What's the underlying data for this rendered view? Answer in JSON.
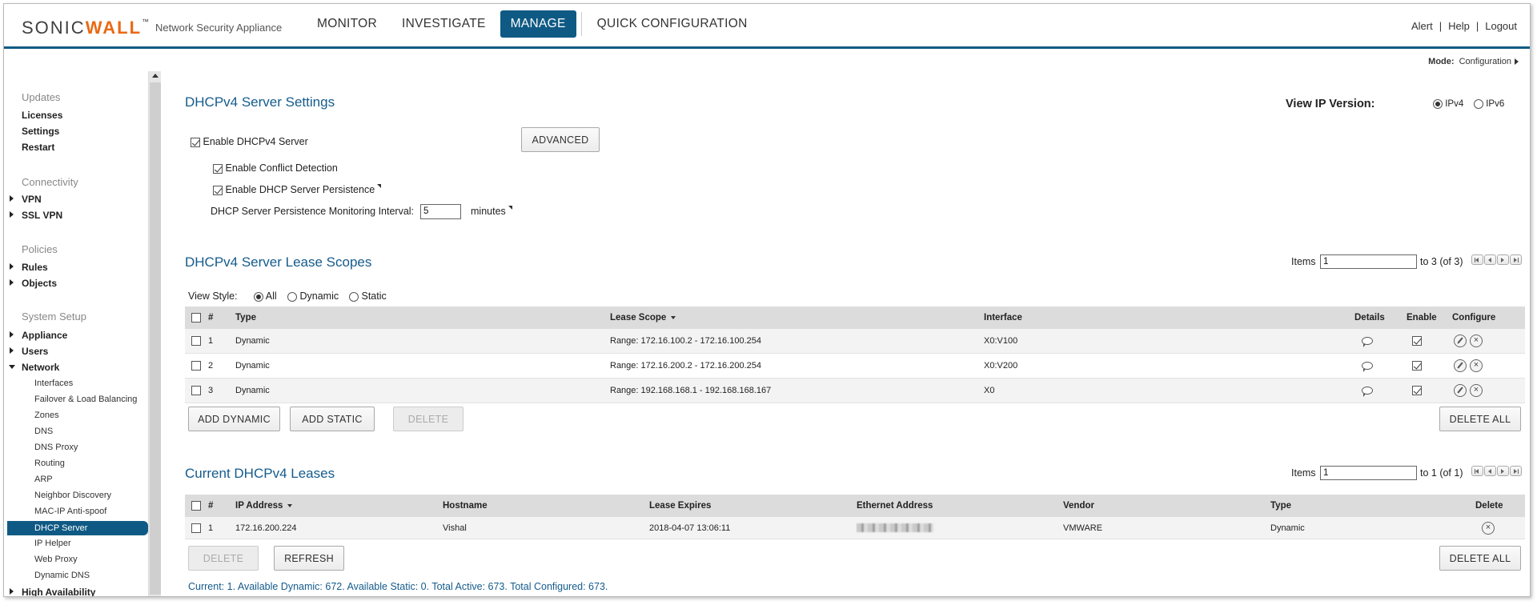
{
  "header": {
    "logo_left": "SONIC",
    "logo_accent": "WALL",
    "logo_tm": "™",
    "product": "Network Security Appliance",
    "nav": [
      "MONITOR",
      "INVESTIGATE",
      "MANAGE",
      "QUICK CONFIGURATION"
    ],
    "active_nav": "MANAGE",
    "links": [
      "Alert",
      "Help",
      "Logout"
    ],
    "separator": "|"
  },
  "mode": {
    "label": "Mode:",
    "value": "Configuration"
  },
  "sidebar": {
    "updates": {
      "heading": "Updates",
      "items": [
        "Licenses",
        "Settings",
        "Restart"
      ]
    },
    "connectivity": {
      "heading": "Connectivity",
      "items": [
        "VPN",
        "SSL VPN"
      ]
    },
    "policies": {
      "heading": "Policies",
      "items": [
        "Rules",
        "Objects"
      ]
    },
    "system_setup": {
      "heading": "System Setup",
      "items": [
        "Appliance",
        "Users",
        "Network"
      ],
      "network_sub": [
        "Interfaces",
        "Failover & Load Balancing",
        "Zones",
        "DNS",
        "DNS Proxy",
        "Routing",
        "ARP",
        "Neighbor Discovery",
        "MAC-IP Anti-spoof",
        "DHCP Server",
        "IP Helper",
        "Web Proxy",
        "Dynamic DNS"
      ],
      "selected": "DHCP Server",
      "after": "High Availability"
    }
  },
  "settings": {
    "title": "DHCPv4 Server Settings",
    "view_ip_label": "View IP Version:",
    "ip_options": [
      "IPv4",
      "IPv6"
    ],
    "ip_selected": "IPv4",
    "enable_server": "Enable DHCPv4 Server",
    "advanced_button": "ADVANCED",
    "conflict_detection": "Enable Conflict Detection",
    "persistence": "Enable DHCP Server Persistence",
    "interval_label": "DHCP Server Persistence Monitoring Interval:",
    "interval_value": "5",
    "interval_unit": "minutes"
  },
  "scopes": {
    "title": "DHCPv4 Server Lease Scopes",
    "items_label": "Items",
    "items_value": "1",
    "items_range": "to 3 (of 3)",
    "view_style_label": "View Style:",
    "view_styles": [
      "All",
      "Dynamic",
      "Static"
    ],
    "view_style_selected": "All",
    "columns": [
      "#",
      "Type",
      "Lease Scope",
      "Interface",
      "Details",
      "Enable",
      "Configure"
    ],
    "rows": [
      {
        "num": "1",
        "type": "Dynamic",
        "scope": "Range: 172.16.100.2 - 172.16.100.254",
        "iface": "X0:V100"
      },
      {
        "num": "2",
        "type": "Dynamic",
        "scope": "Range: 172.16.200.2 - 172.16.200.254",
        "iface": "X0:V200"
      },
      {
        "num": "3",
        "type": "Dynamic",
        "scope": "Range: 192.168.168.1 - 192.168.168.167",
        "iface": "X0"
      }
    ],
    "buttons": {
      "add_dynamic": "ADD DYNAMIC",
      "add_static": "ADD STATIC",
      "delete": "DELETE",
      "delete_all": "DELETE ALL"
    }
  },
  "leases": {
    "title": "Current DHCPv4 Leases",
    "items_label": "Items",
    "items_value": "1",
    "items_range": "to 1 (of 1)",
    "columns": [
      "#",
      "IP Address",
      "Hostname",
      "Lease Expires",
      "Ethernet Address",
      "Vendor",
      "Type",
      "Delete"
    ],
    "rows": [
      {
        "num": "1",
        "ip": "172.16.200.224",
        "host": "Vishal",
        "expires": "2018-04-07 13:06:11",
        "vendor": "VMWARE",
        "type": "Dynamic"
      }
    ],
    "buttons": {
      "delete": "DELETE",
      "refresh": "REFRESH",
      "delete_all": "DELETE ALL"
    },
    "status": "Current: 1. Available Dynamic: 672. Available Static: 0. Total Active: 673. Total Configured: 673."
  },
  "icons": {
    "close": "×"
  },
  "colors": {
    "brand_blue": "#0f5a84",
    "heading_blue": "#145b8c",
    "logo_orange": "#e96a14"
  }
}
